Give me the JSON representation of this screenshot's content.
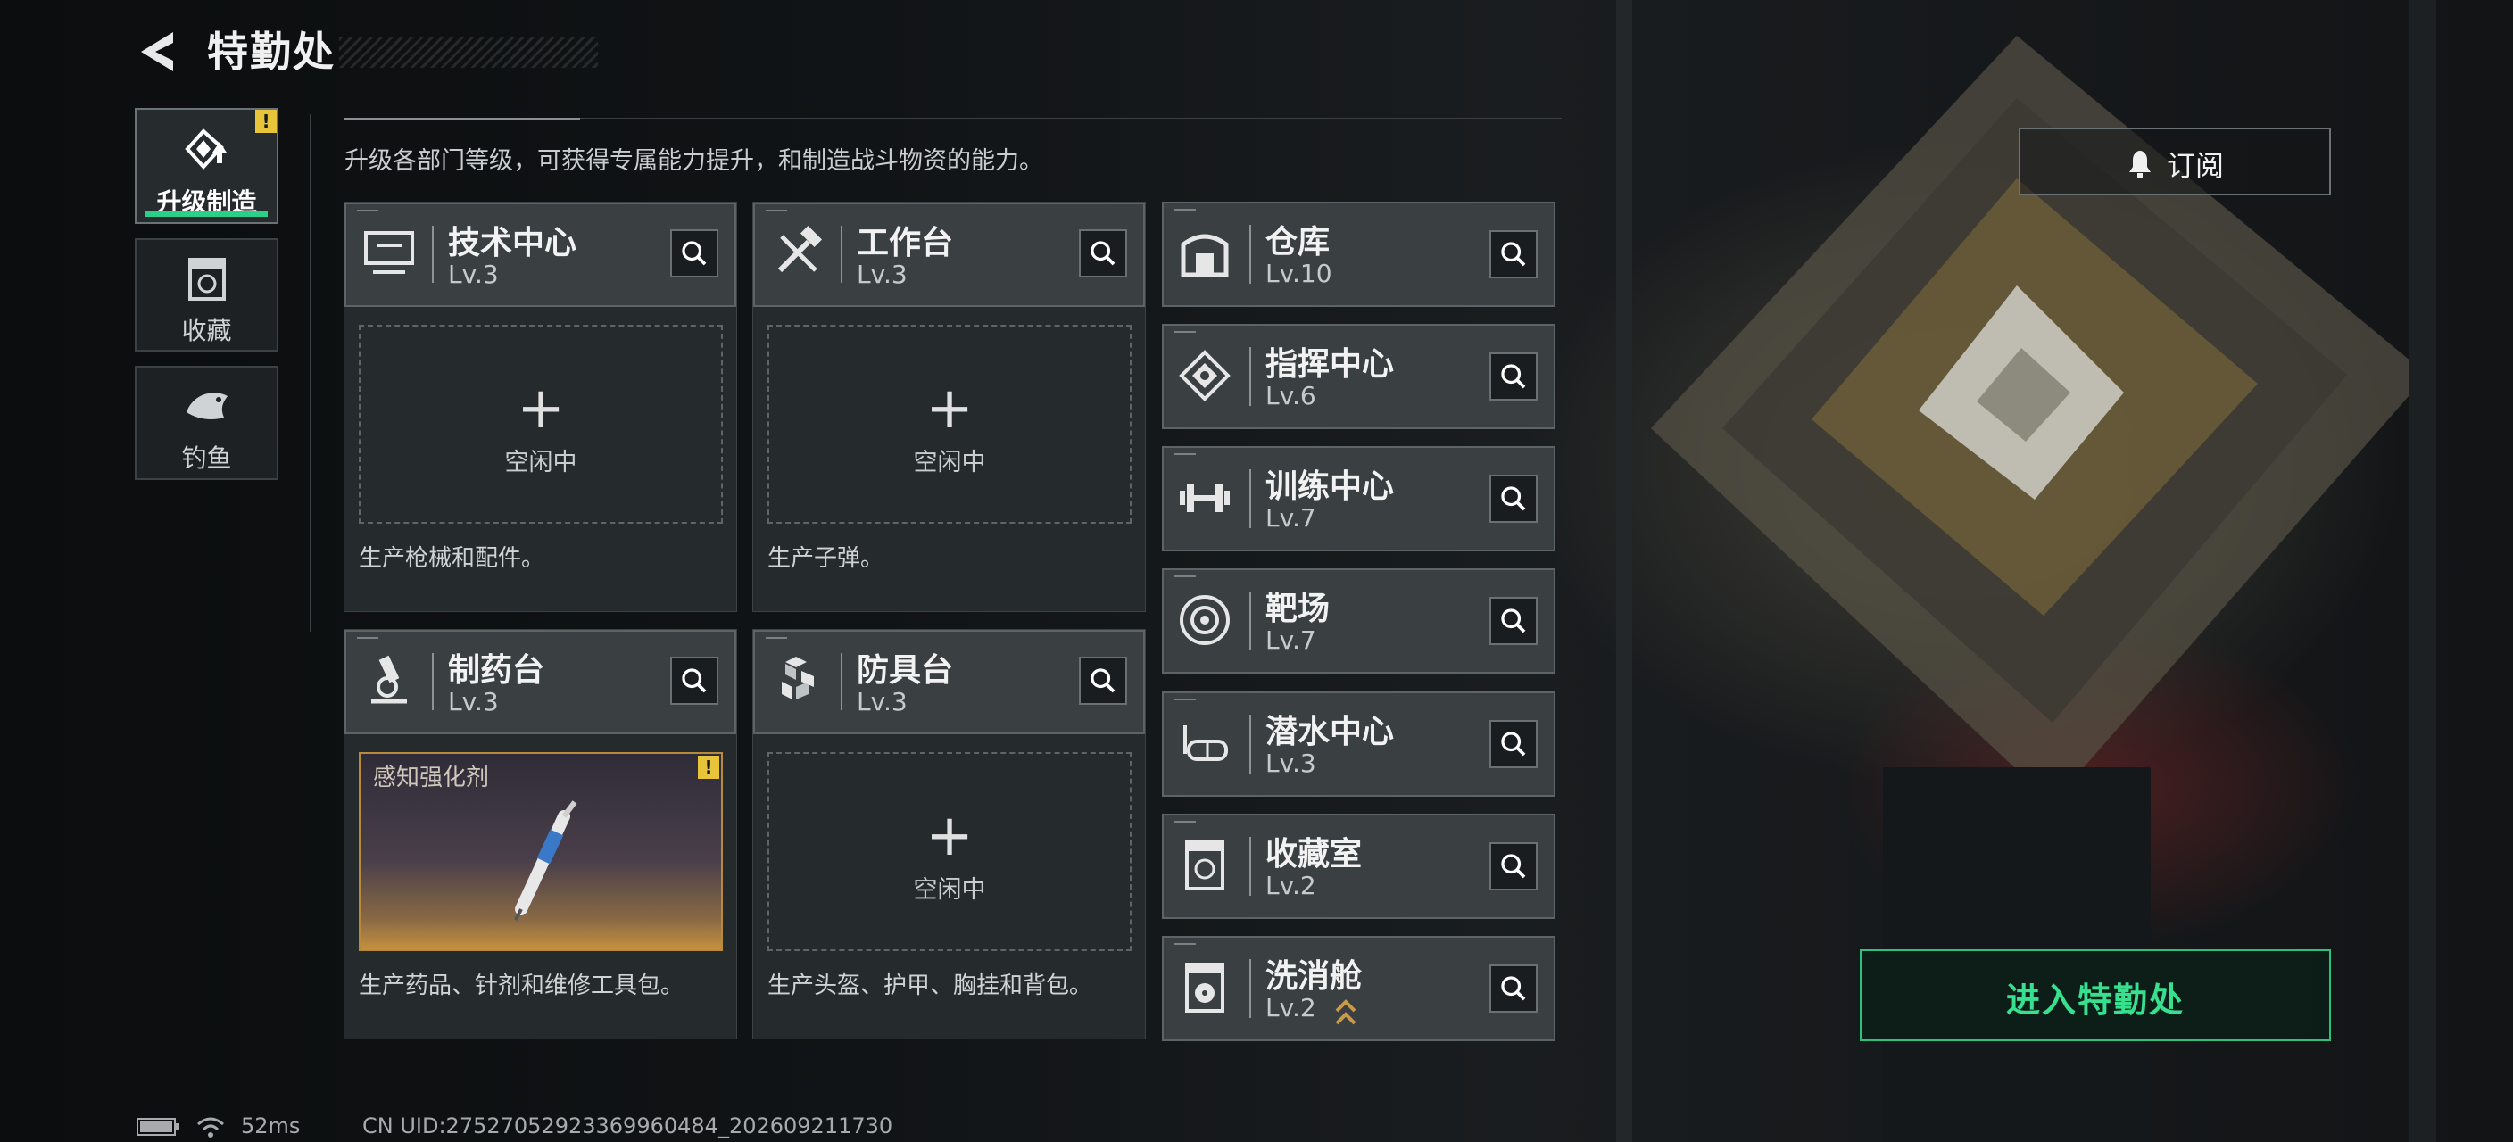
{
  "header": {
    "title": "特勤处"
  },
  "sidebar": {
    "items": [
      {
        "label": "升级制造",
        "active": true,
        "badge": "!"
      },
      {
        "label": "收藏"
      },
      {
        "label": "钓鱼"
      }
    ]
  },
  "subtitle": "升级各部门等级，可获得专属能力提升，和制造战斗物资的能力。",
  "stations": [
    {
      "name": "技术中心",
      "level": "Lv.3",
      "slot_text": "空闲中",
      "slot_plus": "+",
      "desc": "生产枪械和配件。"
    },
    {
      "name": "工作台",
      "level": "Lv.3",
      "slot_text": "空闲中",
      "slot_plus": "+",
      "desc": "生产子弹。"
    },
    {
      "name": "制药台",
      "level": "Lv.3",
      "item_name": "感知强化剂",
      "item_badge": "!",
      "desc": "生产药品、针剂和维修工具包。"
    },
    {
      "name": "防具台",
      "level": "Lv.3",
      "slot_text": "空闲中",
      "slot_plus": "+",
      "desc": "生产头盔、护甲、胸挂和背包。"
    }
  ],
  "facilities": [
    {
      "name": "仓库",
      "level": "Lv.10",
      "icon": "warehouse-icon"
    },
    {
      "name": "指挥中心",
      "level": "Lv.6",
      "icon": "command-chip-icon"
    },
    {
      "name": "训练中心",
      "level": "Lv.7",
      "icon": "dumbbell-icon"
    },
    {
      "name": "靶场",
      "level": "Lv.7",
      "icon": "target-icon"
    },
    {
      "name": "潜水中心",
      "level": "Lv.3",
      "icon": "diving-mask-icon"
    },
    {
      "name": "收藏室",
      "level": "Lv.2",
      "icon": "collection-icon"
    },
    {
      "name": "洗消舱",
      "level": "Lv.2",
      "icon": "decontamination-icon",
      "upgradable": true
    }
  ],
  "subscribe_label": "订阅",
  "enter_label": "进入特勤处",
  "status": {
    "ping": "52ms",
    "uid": "CN UID:27527052923369960484_202609211730"
  },
  "colors": {
    "accent_green": "#36e08f",
    "warning_yellow": "#e8c43a",
    "card_bg": "#3a3f42",
    "upgrade_gold": "#c89a4a"
  }
}
